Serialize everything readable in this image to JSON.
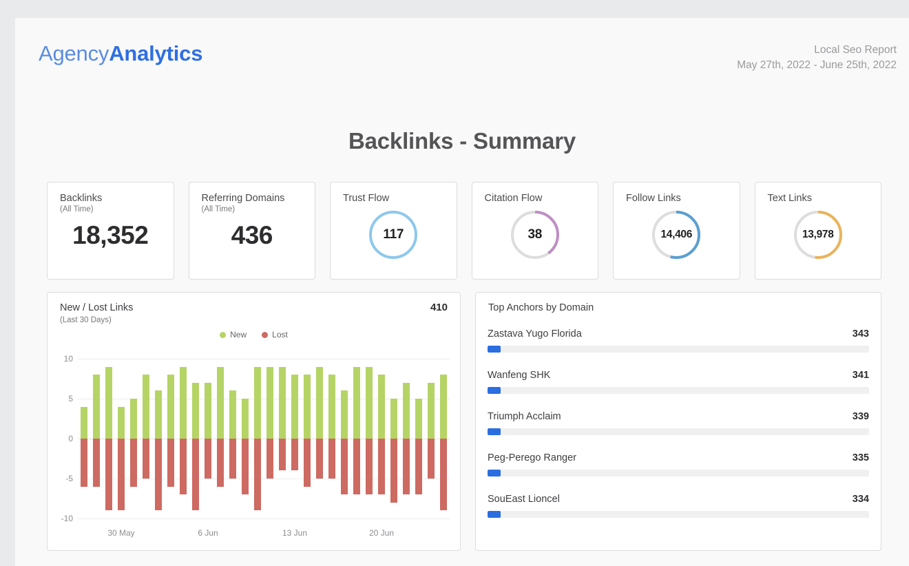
{
  "header": {
    "logo_light": "Agency",
    "logo_bold": "Analytics",
    "report_name": "Local Seo Report",
    "date_range": "May 27th, 2022 - June 25th, 2022"
  },
  "page_title": "Backlinks - Summary",
  "kpis": [
    {
      "title": "Backlinks",
      "subtitle": "(All Time)",
      "value": "18,352",
      "type": "number"
    },
    {
      "title": "Referring Domains",
      "subtitle": "(All Time)",
      "value": "436",
      "type": "number"
    },
    {
      "title": "Trust Flow",
      "subtitle": "",
      "value": "117",
      "type": "ring",
      "percent": 100,
      "color": "#8ec8ec"
    },
    {
      "title": "Citation Flow",
      "subtitle": "",
      "value": "38",
      "type": "ring",
      "percent": 40,
      "color": "#c08ec4"
    },
    {
      "title": "Follow Links",
      "subtitle": "",
      "value": "14,406",
      "type": "ring",
      "percent": 54,
      "color": "#5a9fd1"
    },
    {
      "title": "Text Links",
      "subtitle": "",
      "value": "13,978",
      "type": "ring",
      "percent": 52,
      "color": "#e8b45c"
    }
  ],
  "chart_panel": {
    "title": "New / Lost Links",
    "subtitle": "(Last 30 Days)",
    "total": "410",
    "legend": [
      {
        "label": "New",
        "color": "#b5d465"
      },
      {
        "label": "Lost",
        "color": "#cd6a62"
      }
    ]
  },
  "anchors_panel": {
    "title": "Top Anchors by Domain",
    "max": 9800,
    "rows": [
      {
        "name": "Zastava Yugo Florida",
        "value": "343",
        "percent": 3.5
      },
      {
        "name": "Wanfeng SHK",
        "value": "341",
        "percent": 3.5
      },
      {
        "name": "Triumph Acclaim",
        "value": "339",
        "percent": 3.5
      },
      {
        "name": "Peg-Perego Ranger",
        "value": "335",
        "percent": 3.4
      },
      {
        "name": "SouEast Lioncel",
        "value": "334",
        "percent": 3.4
      }
    ]
  },
  "chart_data": {
    "type": "bar",
    "title": "New / Lost Links",
    "subtitle": "(Last 30 Days)",
    "xlabel": "",
    "ylabel": "",
    "ylim": [
      -10,
      10
    ],
    "yticks": [
      10,
      5,
      0,
      -5,
      -10
    ],
    "ytick_labels": [
      "10",
      "5",
      "0",
      "-5",
      "-10"
    ],
    "grid": true,
    "legend_position": "top-center",
    "stacked": false,
    "x": [
      "27 May",
      "28 May",
      "29 May",
      "30 May",
      "31 May",
      "1 Jun",
      "2 Jun",
      "3 Jun",
      "4 Jun",
      "5 Jun",
      "6 Jun",
      "7 Jun",
      "8 Jun",
      "9 Jun",
      "10 Jun",
      "11 Jun",
      "12 Jun",
      "13 Jun",
      "14 Jun",
      "15 Jun",
      "16 Jun",
      "17 Jun",
      "18 Jun",
      "19 Jun",
      "20 Jun",
      "21 Jun",
      "22 Jun",
      "23 Jun",
      "24 Jun",
      "25 Jun"
    ],
    "xtick_labels": [
      {
        "label": "30 May",
        "index": 3
      },
      {
        "label": "6 Jun",
        "index": 10
      },
      {
        "label": "13 Jun",
        "index": 17
      },
      {
        "label": "20 Jun",
        "index": 24
      }
    ],
    "series": [
      {
        "name": "New",
        "color": "#b5d465",
        "values": [
          4,
          8,
          9,
          4,
          5,
          8,
          6,
          8,
          9,
          7,
          7,
          9,
          6,
          5,
          9,
          9,
          9,
          8,
          8,
          9,
          8,
          6,
          9,
          9,
          8,
          5,
          7,
          5,
          7,
          8
        ]
      },
      {
        "name": "Lost",
        "color": "#cd6a62",
        "values": [
          -6,
          -6,
          -9,
          -9,
          -6,
          -5,
          -9,
          -6,
          -7,
          -9,
          -5,
          -6,
          -5,
          -7,
          -9,
          -5,
          -4,
          -4,
          -6,
          -5,
          -5,
          -7,
          -7,
          -7,
          -7,
          -8,
          -7,
          -7,
          -5,
          -9
        ]
      }
    ]
  }
}
